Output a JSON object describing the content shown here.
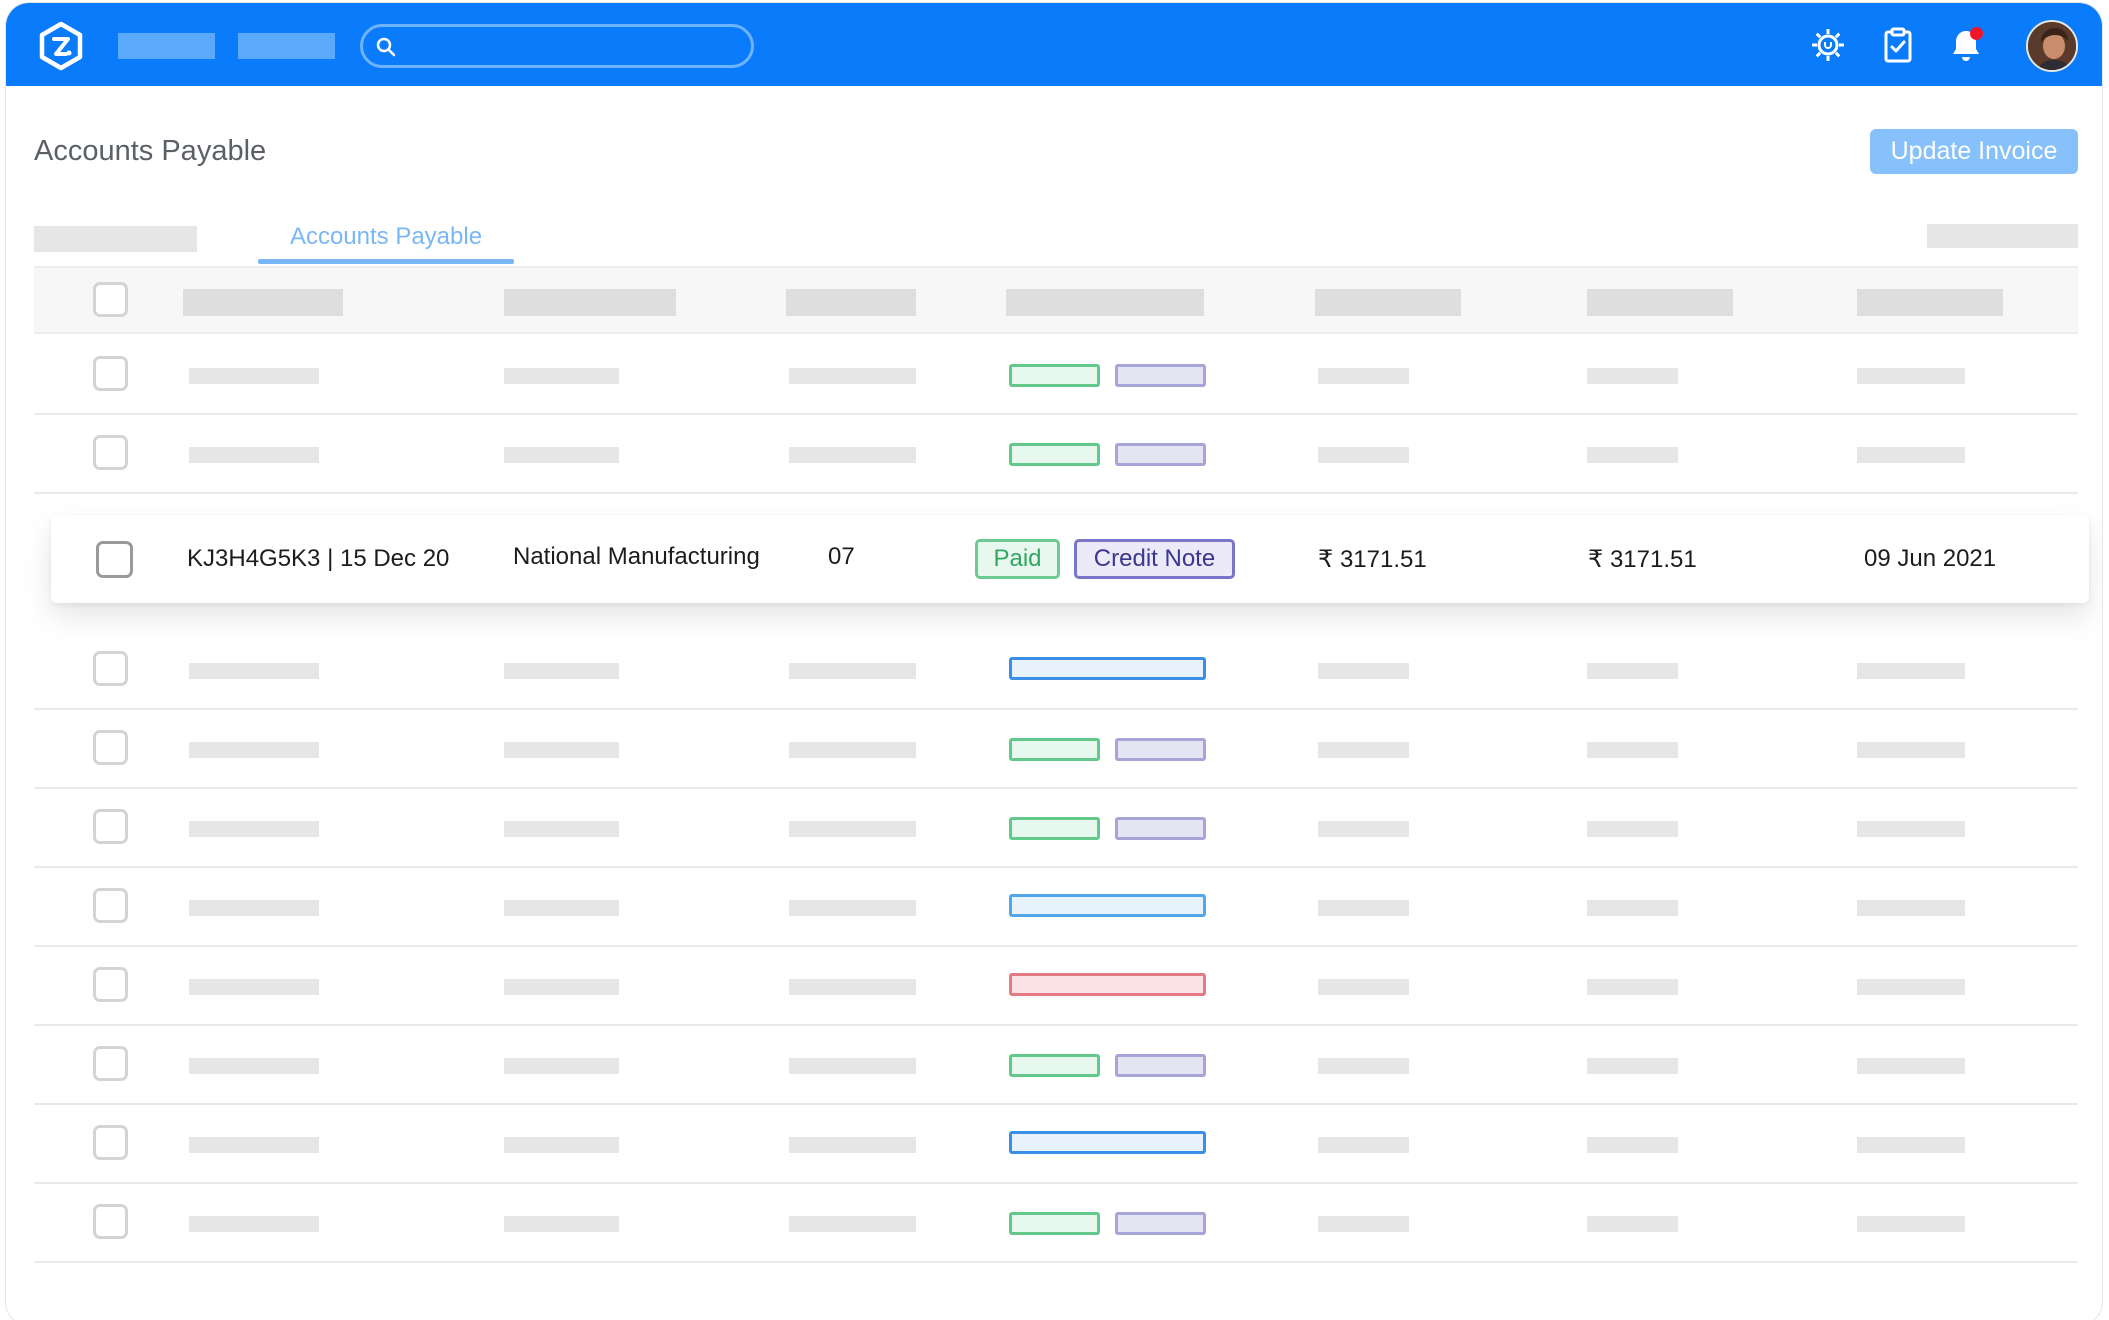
{
  "header": {
    "search_placeholder": ""
  },
  "page": {
    "title": "Accounts Payable",
    "update_button": "Update Invoice"
  },
  "tabs": {
    "active": "Accounts Payable"
  },
  "highlighted_row": {
    "invoice": "KJ3H4G5K3 | 15 Dec 20",
    "vendor": "National Manufacturing",
    "count": "07",
    "status_paid": "Paid",
    "status_type": "Credit Note",
    "amount_1": "₹ 3171.51",
    "amount_2": "₹ 3171.51",
    "date": "09 Jun 2021"
  },
  "colors": {
    "topbar": "#0a7cfb",
    "button": "#87c1fb",
    "tab_active": "#7ab7f6",
    "paid": "#62c98b",
    "credit": "#7b75c8",
    "error": "#e47a84"
  },
  "icons": {
    "logo": "brand-logo-icon",
    "search": "search-icon",
    "settings": "settings-gear-icon",
    "tasks": "clipboard-check-icon",
    "notifications": "bell-icon",
    "user": "avatar"
  }
}
